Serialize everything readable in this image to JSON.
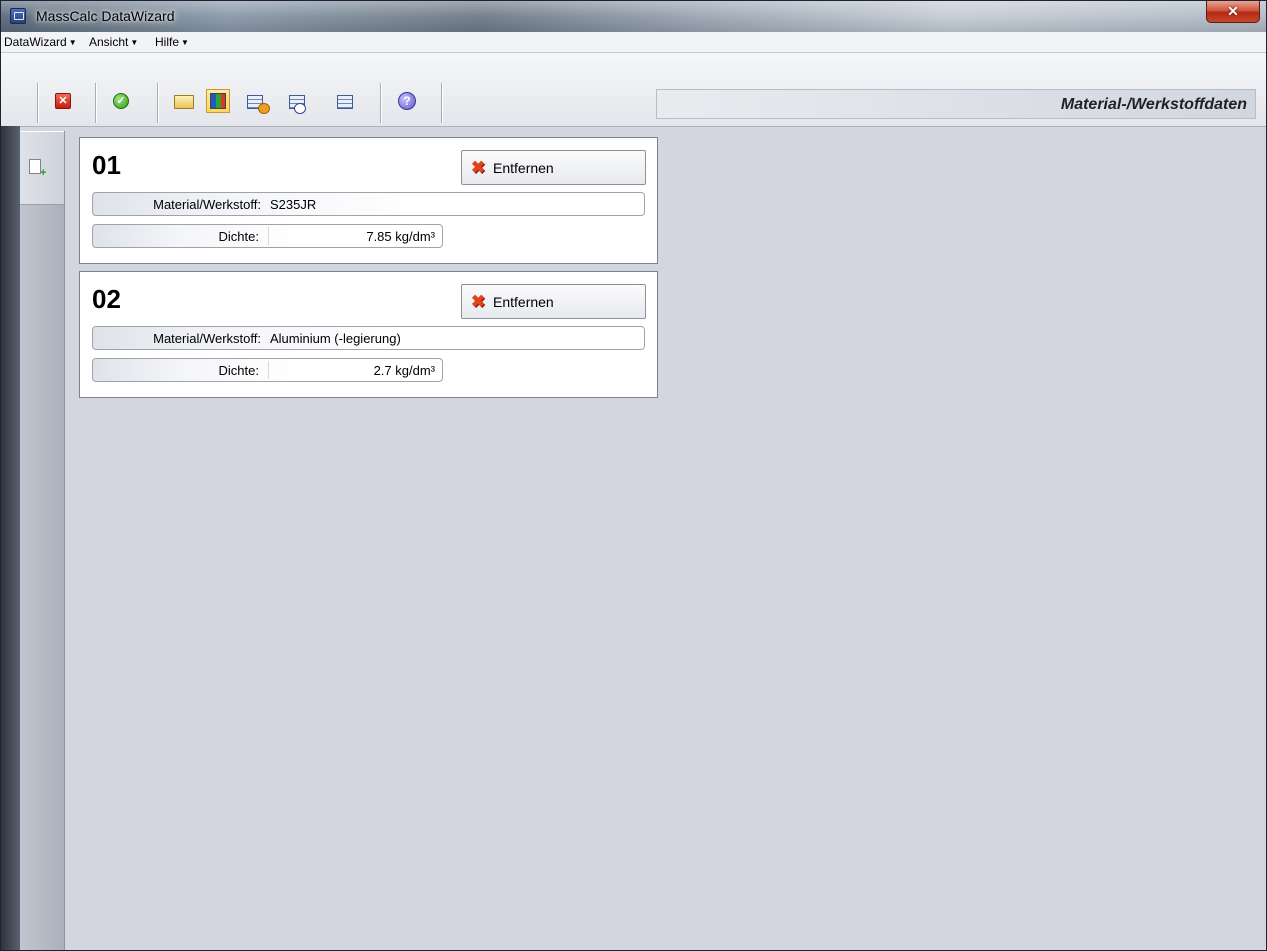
{
  "window": {
    "title": "MassCalc DataWizard"
  },
  "menu": [
    {
      "label": "DataWizard"
    },
    {
      "label": "Ansicht"
    },
    {
      "label": "Hilfe"
    }
  ],
  "toolbar": {
    "icons": [
      "close-icon",
      "check-icon",
      "folder-icon",
      "grid-view-icon",
      "table-import-icon",
      "table-swap-icon",
      "table-export-icon",
      "help-icon"
    ],
    "active": "grid-view-icon"
  },
  "section_header": "Material-/Werkstoffdaten",
  "records": [
    {
      "number": "01",
      "remove_label": "Entfernen",
      "material_label": "Material/Werkstoff:",
      "material_value": "S235JR",
      "density_label": "Dichte:",
      "density_value": "7.85 kg/dm³"
    },
    {
      "number": "02",
      "remove_label": "Entfernen",
      "material_label": "Material/Werkstoff:",
      "material_value": "Aluminium (-legierung)",
      "density_label": "Dichte:",
      "density_value": "2.7 kg/dm³"
    }
  ],
  "colors": {
    "accent_active": "#ffd55b",
    "remove_x": "#e2421c",
    "background": "#d3d6de"
  }
}
